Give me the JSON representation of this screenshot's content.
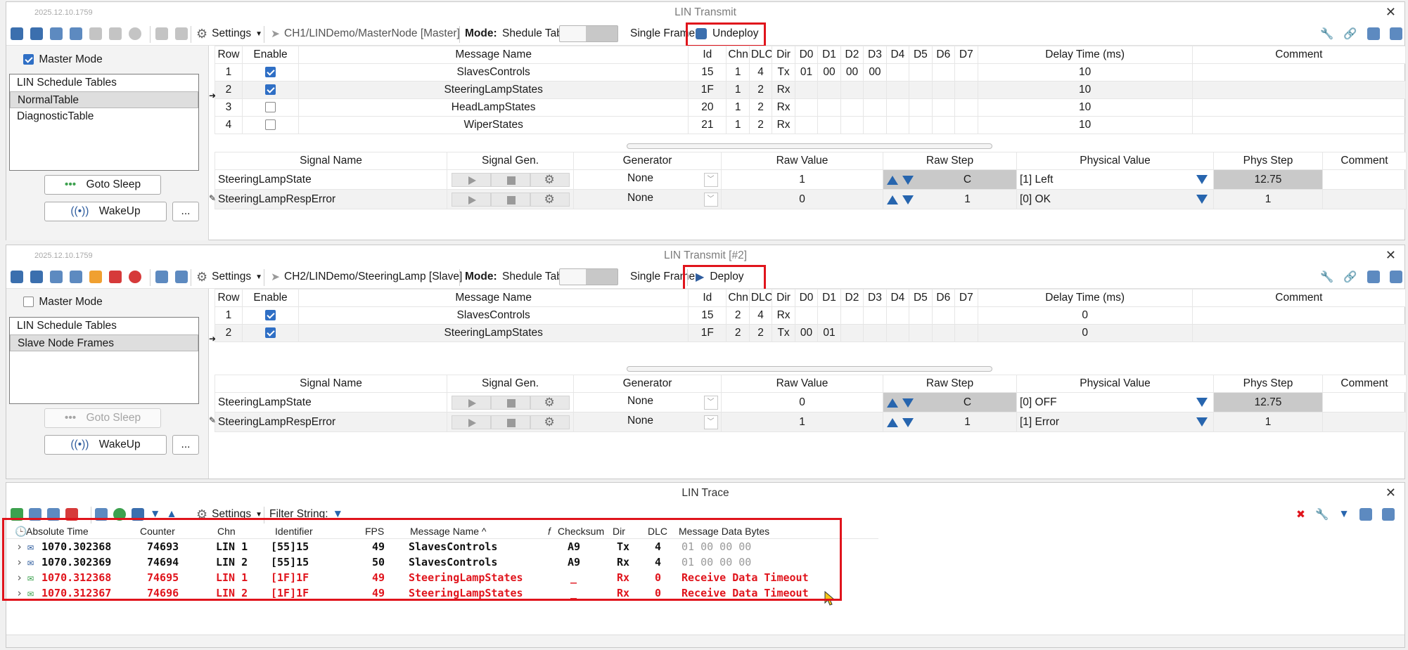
{
  "panel1": {
    "version": "2025.12.10.1759",
    "title": "LIN Transmit",
    "settings_label": "Settings",
    "node_path": "CH1/LINDemo/MasterNode [Master]",
    "mode_label": "Mode:",
    "mode_left": "Shedule Table",
    "mode_right": "Single Frame",
    "deploy_label": "Undeploy",
    "master_mode_label": "Master Mode",
    "master_mode_checked": true,
    "schedule_items": [
      "LIN Schedule Tables",
      "NormalTable",
      "DiagnosticTable"
    ],
    "goto_sleep_label": "Goto Sleep",
    "wakeup_label": "WakeUp",
    "more_label": "...",
    "frame_headers": [
      "Row",
      "Enable",
      "Message Name",
      "Id",
      "Chn",
      "DLC",
      "Dir",
      "D0",
      "D1",
      "D2",
      "D3",
      "D4",
      "D5",
      "D6",
      "D7",
      "Delay Time (ms)",
      "Comment"
    ],
    "frames": [
      {
        "row": "1",
        "enable": true,
        "name": "SlavesControls",
        "id": "15",
        "chn": "1",
        "dlc": "4",
        "dir": "Tx",
        "d0": "01",
        "d1": "00",
        "d2": "00",
        "d3": "00",
        "delay": "10"
      },
      {
        "row": "2",
        "enable": true,
        "name": "SteeringLampStates",
        "id": "1F",
        "chn": "1",
        "dlc": "2",
        "dir": "Rx",
        "d0": "",
        "d1": "",
        "d2": "",
        "d3": "",
        "delay": "10"
      },
      {
        "row": "3",
        "enable": false,
        "name": "HeadLampStates",
        "id": "20",
        "chn": "1",
        "dlc": "2",
        "dir": "Rx",
        "d0": "",
        "d1": "",
        "d2": "",
        "d3": "",
        "delay": "10"
      },
      {
        "row": "4",
        "enable": false,
        "name": "WiperStates",
        "id": "21",
        "chn": "1",
        "dlc": "2",
        "dir": "Rx",
        "d0": "",
        "d1": "",
        "d2": "",
        "d3": "",
        "delay": "10"
      }
    ],
    "signal_headers": [
      "Signal Name",
      "Signal Gen.",
      "Generator",
      "Raw Value",
      "Raw Step",
      "Physical Value",
      "Phys Step",
      "Comment"
    ],
    "signals": [
      {
        "name": "SteeringLampState",
        "generator": "None",
        "raw": "1",
        "step": "C",
        "phys": "[1] Left",
        "phys_step": "12.75"
      },
      {
        "name": "SteeringLampRespError",
        "generator": "None",
        "raw": "0",
        "step": "1",
        "phys": "[0] OK",
        "phys_step": "1"
      }
    ]
  },
  "panel2": {
    "version": "2025.12.10.1759",
    "title": "LIN Transmit [#2]",
    "settings_label": "Settings",
    "node_path": "CH2/LINDemo/SteeringLamp [Slave]",
    "mode_label": "Mode:",
    "mode_left": "Shedule Table",
    "mode_right": "Single Frame",
    "deploy_label": "Deploy",
    "master_mode_label": "Master Mode",
    "master_mode_checked": false,
    "schedule_items": [
      "LIN Schedule Tables",
      "Slave Node Frames"
    ],
    "goto_sleep_label": "Goto Sleep",
    "wakeup_label": "WakeUp",
    "more_label": "...",
    "frames": [
      {
        "row": "1",
        "enable": true,
        "name": "SlavesControls",
        "id": "15",
        "chn": "2",
        "dlc": "4",
        "dir": "Rx",
        "d0": "",
        "d1": "",
        "delay": "0"
      },
      {
        "row": "2",
        "enable": true,
        "name": "SteeringLampStates",
        "id": "1F",
        "chn": "2",
        "dlc": "2",
        "dir": "Tx",
        "d0": "00",
        "d1": "01",
        "delay": "0"
      }
    ],
    "signals": [
      {
        "name": "SteeringLampState",
        "generator": "None",
        "raw": "0",
        "step": "C",
        "phys": "[0] OFF",
        "phys_step": "12.75"
      },
      {
        "name": "SteeringLampRespError",
        "generator": "None",
        "raw": "1",
        "step": "1",
        "phys": "[1] Error",
        "phys_step": "1"
      }
    ]
  },
  "trace": {
    "title": "LIN Trace",
    "settings_label": "Settings",
    "filter_label": "Filter String:",
    "headers": [
      "Absolute Time",
      "Counter",
      "Chn",
      "Identifier",
      "FPS",
      "Message Name ^",
      "Checksum",
      "Dir",
      "DLC",
      "Message Data Bytes"
    ],
    "rows": [
      {
        "time": "1070.302368",
        "counter": "74693",
        "chn": "LIN 1",
        "ident": "[55]15",
        "fps": "49",
        "name": "SlavesControls",
        "checksum": "A9",
        "dir": "Tx",
        "dlc": "4",
        "data": "01 00 00 00"
      },
      {
        "time": "1070.302369",
        "counter": "74694",
        "chn": "LIN 2",
        "ident": "[55]15",
        "fps": "50",
        "name": "SlavesControls",
        "checksum": "A9",
        "dir": "Rx",
        "dlc": "4",
        "data": "01 00 00 00"
      },
      {
        "time": "1070.312368",
        "counter": "74695",
        "chn": "LIN 1",
        "ident": "[1F]1F",
        "fps": "49",
        "name": "SteeringLampStates",
        "checksum": "_",
        "dir": "Rx",
        "dlc": "0",
        "data": "Receive Data Timeout"
      },
      {
        "time": "1070.312367",
        "counter": "74696",
        "chn": "LIN 2",
        "ident": "[1F]1F",
        "fps": "49",
        "name": "SteeringLampStates",
        "checksum": "_",
        "dir": "Rx",
        "dlc": "0",
        "data": "Receive Data Timeout"
      }
    ]
  },
  "colors": {
    "highlight": "#e0141c",
    "accent": "#2765ae"
  }
}
